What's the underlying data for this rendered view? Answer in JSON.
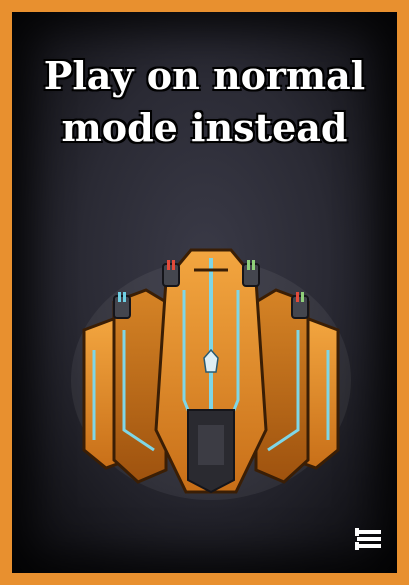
{
  "card": {
    "title": "Play on normal mode instead",
    "border_color": "#e8902f",
    "ship_icon": "spaceship-icon",
    "menu_icon": "hamburger-menu-icon"
  }
}
